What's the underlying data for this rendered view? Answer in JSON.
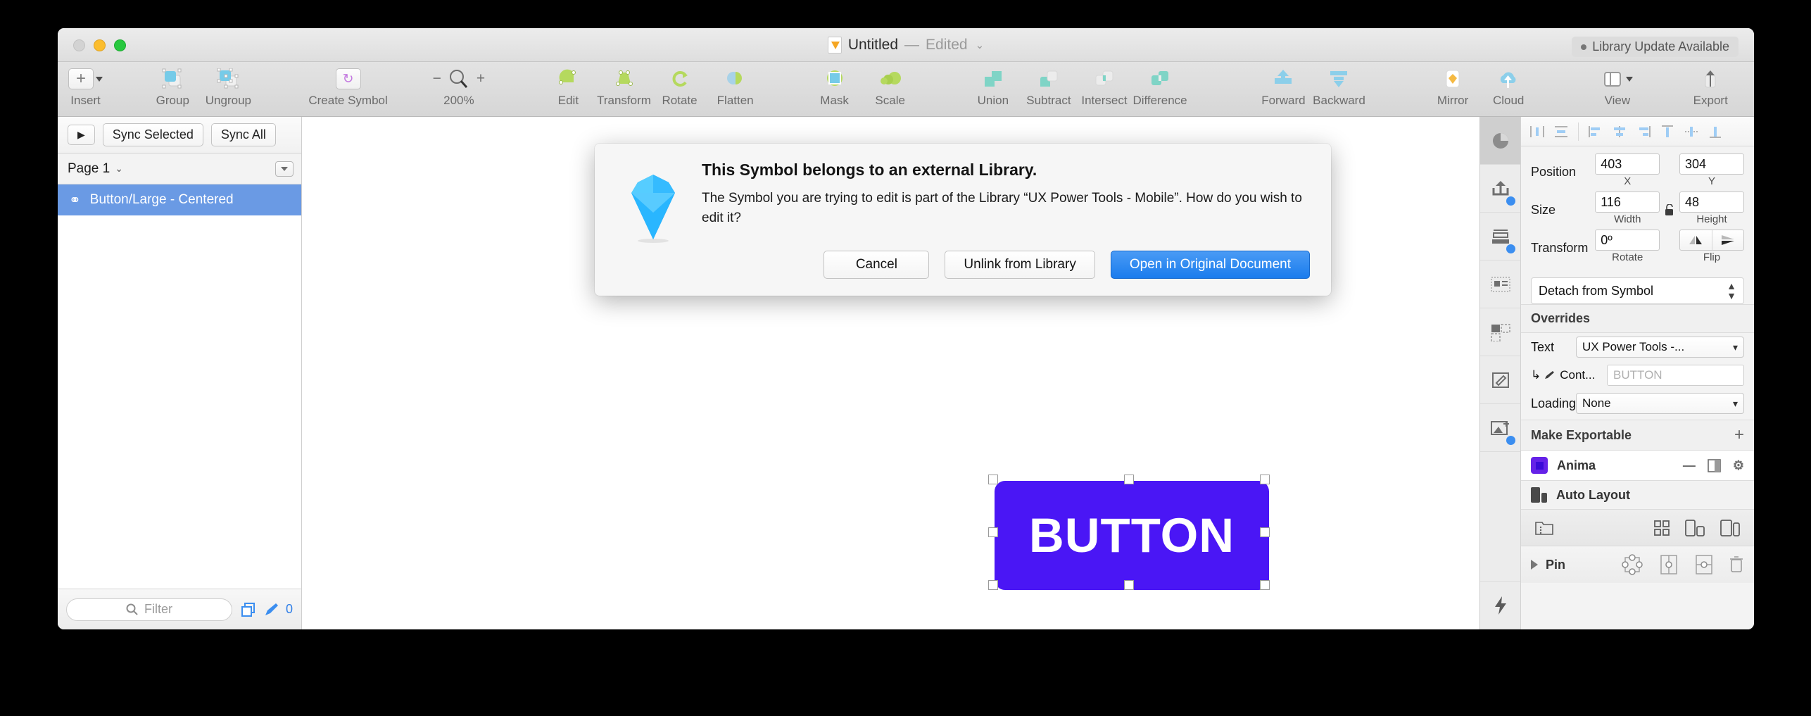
{
  "window": {
    "title_name": "Untitled",
    "title_dash": "—",
    "title_edited": "Edited",
    "title_chevron": "⌄",
    "library_update": "Library Update Available"
  },
  "toolbar": {
    "items": [
      {
        "label": "Insert",
        "icon": "plus-icon"
      },
      {
        "label": "Group",
        "icon": "group-icon"
      },
      {
        "label": "Ungroup",
        "icon": "ungroup-icon"
      },
      {
        "label": "Create Symbol",
        "icon": "create-symbol-icon"
      },
      {
        "label": "Edit",
        "icon": "edit-icon"
      },
      {
        "label": "Transform",
        "icon": "transform-icon"
      },
      {
        "label": "Rotate",
        "icon": "rotate-icon"
      },
      {
        "label": "Flatten",
        "icon": "flatten-icon"
      },
      {
        "label": "Mask",
        "icon": "mask-icon"
      },
      {
        "label": "Scale",
        "icon": "scale-icon"
      },
      {
        "label": "Union",
        "icon": "union-icon"
      },
      {
        "label": "Subtract",
        "icon": "subtract-icon"
      },
      {
        "label": "Intersect",
        "icon": "intersect-icon"
      },
      {
        "label": "Difference",
        "icon": "difference-icon"
      },
      {
        "label": "Forward",
        "icon": "forward-icon"
      },
      {
        "label": "Backward",
        "icon": "backward-icon"
      },
      {
        "label": "Mirror",
        "icon": "mirror-icon"
      },
      {
        "label": "Cloud",
        "icon": "cloud-icon"
      },
      {
        "label": "View",
        "icon": "view-icon"
      },
      {
        "label": "Export",
        "icon": "export-icon"
      }
    ],
    "zoom_level": "200%",
    "zoom_out": "−",
    "zoom_in": "+"
  },
  "sidebar": {
    "sync_play": "▶",
    "sync_selected": "Sync Selected",
    "sync_all": "Sync All",
    "page_name": "Page 1",
    "page_chevron": "⌄",
    "layers": [
      {
        "name": "Button/Large - Centered",
        "selected": true
      }
    ],
    "filter_placeholder": "Filter",
    "filter_value": "",
    "count": "0"
  },
  "canvas": {
    "button_label": "BUTTON",
    "button_color": "#4a16f5"
  },
  "inspector": {
    "position_label": "Position",
    "position_x": "403",
    "position_y": "304",
    "x_sub": "X",
    "y_sub": "Y",
    "size_label": "Size",
    "width": "116",
    "height": "48",
    "width_sub": "Width",
    "height_sub": "Height",
    "transform_label": "Transform",
    "rotate": "0º",
    "rotate_sub": "Rotate",
    "flip_sub": "Flip",
    "detach_label": "Detach from Symbol",
    "overrides_header": "Overrides",
    "text_label": "Text",
    "text_value": "UX Power Tools -...",
    "content_label": "Cont...",
    "content_placeholder": "BUTTON",
    "loading_label": "Loading",
    "loading_value": "None",
    "make_exportable": "Make Exportable",
    "anima_label": "Anima",
    "auto_layout_label": "Auto Layout",
    "pin_label": "Pin"
  },
  "dialog": {
    "title": "This Symbol belongs to an external Library.",
    "body": "The Symbol you are trying to edit is part of the Library “UX Power Tools - Mobile”. How do you wish to edit it?",
    "cancel": "Cancel",
    "unlink": "Unlink from Library",
    "open_original": "Open in Original Document"
  }
}
